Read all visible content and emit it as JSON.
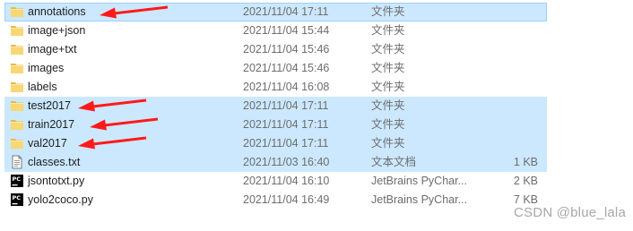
{
  "rows": [
    {
      "name": "annotations",
      "date": "2021/11/04 17:11",
      "type": "文件夹",
      "size": "",
      "icon": "folder-icon",
      "selected": true,
      "arrow": true
    },
    {
      "name": "image+json",
      "date": "2021/11/04 15:44",
      "type": "文件夹",
      "size": "",
      "icon": "folder-icon",
      "selected": false,
      "arrow": false
    },
    {
      "name": "image+txt",
      "date": "2021/11/04 15:46",
      "type": "文件夹",
      "size": "",
      "icon": "folder-icon",
      "selected": false,
      "arrow": false
    },
    {
      "name": "images",
      "date": "2021/11/04 15:46",
      "type": "文件夹",
      "size": "",
      "icon": "folder-icon",
      "selected": false,
      "arrow": false
    },
    {
      "name": "labels",
      "date": "2021/11/04 16:08",
      "type": "文件夹",
      "size": "",
      "icon": "folder-icon",
      "selected": false,
      "arrow": false
    },
    {
      "name": "test2017",
      "date": "2021/11/04 17:11",
      "type": "文件夹",
      "size": "",
      "icon": "folder-icon",
      "selected": true,
      "arrow": true
    },
    {
      "name": "train2017",
      "date": "2021/11/04 17:11",
      "type": "文件夹",
      "size": "",
      "icon": "folder-icon",
      "selected": true,
      "arrow": true
    },
    {
      "name": "val2017",
      "date": "2021/11/04 17:11",
      "type": "文件夹",
      "size": "",
      "icon": "folder-icon",
      "selected": true,
      "arrow": true
    },
    {
      "name": "classes.txt",
      "date": "2021/11/03 16:40",
      "type": "文本文档",
      "size": "1 KB",
      "icon": "text-file-icon",
      "selected": true,
      "arrow": false
    },
    {
      "name": "jsontotxt.py",
      "date": "2021/11/04 16:10",
      "type": "JetBrains PyChar...",
      "size": "2 KB",
      "icon": "pycharm-file-icon",
      "selected": false,
      "arrow": false
    },
    {
      "name": "yolo2coco.py",
      "date": "2021/11/04 16:49",
      "type": "JetBrains PyChar...",
      "size": "7 KB",
      "icon": "pycharm-file-icon",
      "selected": false,
      "arrow": false
    }
  ],
  "watermark": "CSDN @blue_lala",
  "colors": {
    "selection": "#cce8ff",
    "selection_border": "#99d1ff",
    "folder": "#f8d775",
    "arrow": "#ff1a1a",
    "secondary_text": "#6d6d6d"
  }
}
